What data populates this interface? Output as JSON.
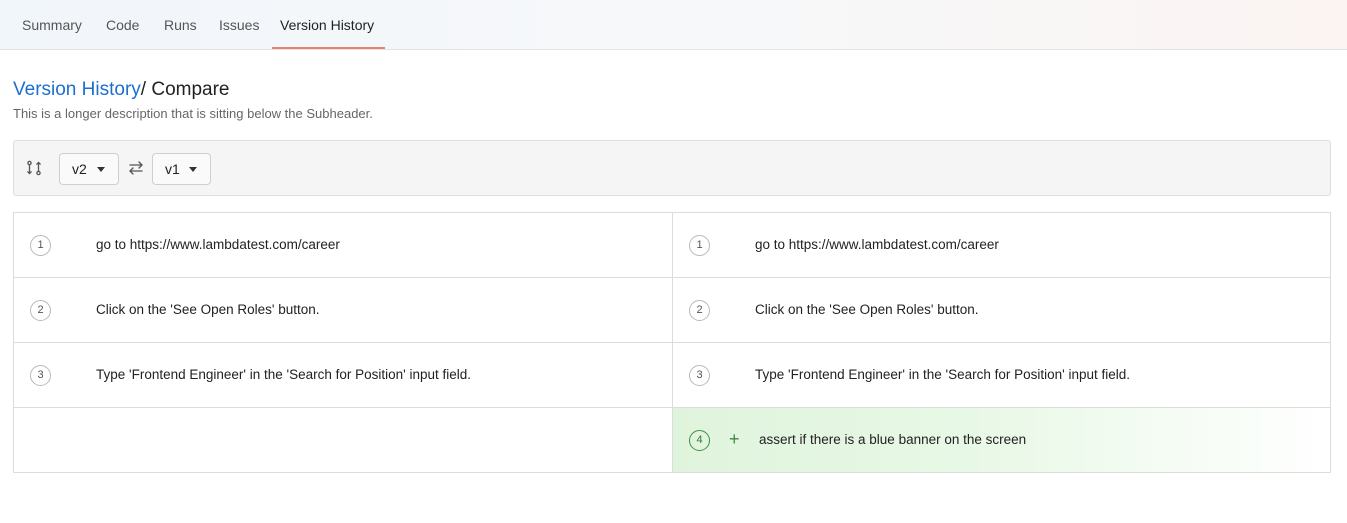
{
  "tabs": [
    {
      "label": "Summary"
    },
    {
      "label": "Code"
    },
    {
      "label": "Runs"
    },
    {
      "label": "Issues"
    },
    {
      "label": "Version History",
      "active": true
    }
  ],
  "breadcrumb": {
    "parent": "Version History",
    "separator": "/ ",
    "current": "Compare"
  },
  "description": "This is a longer description that is sitting below the Subheader.",
  "toolbar": {
    "left_version": "v2",
    "right_version": "v1",
    "icons": [
      "compare-branches-icon",
      "swap-arrows-icon",
      "caret-down-icon"
    ]
  },
  "compare": {
    "left": [
      {
        "num": "1",
        "text": "go to https://www.lambdatest.com/career"
      },
      {
        "num": "2",
        "text": "Click on the 'See Open Roles' button."
      },
      {
        "num": "3",
        "text": "Type 'Frontend Engineer' in the 'Search for Position' input field."
      }
    ],
    "right": [
      {
        "num": "1",
        "text": "go to https://www.lambdatest.com/career"
      },
      {
        "num": "2",
        "text": "Click on the 'See Open Roles' button."
      },
      {
        "num": "3",
        "text": "Type 'Frontend Engineer' in the 'Search for Position' input field."
      },
      {
        "num": "4",
        "text": "assert if there is a blue banner on the screen",
        "status": "added",
        "marker": "+"
      }
    ]
  },
  "colors": {
    "accent_link": "#1c6fd0",
    "active_tab_underline": "#e8826e",
    "added_background": "#dff4dd",
    "added_accent": "#3a8a43"
  }
}
